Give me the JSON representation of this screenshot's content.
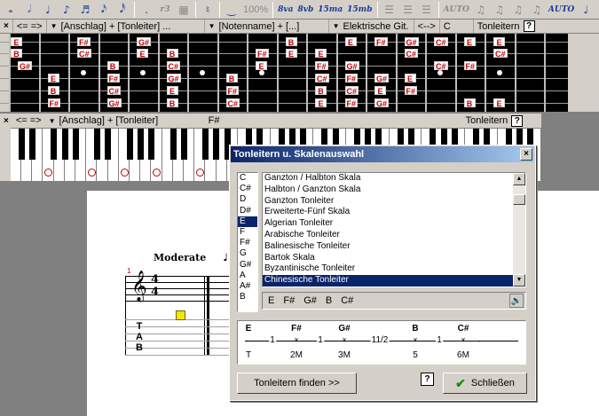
{
  "toolbar": {
    "items": [
      "𝅝",
      "𝅗𝅥",
      "♩",
      "♪",
      "♬",
      "𝅘𝅥𝅯",
      "𝅘𝅥𝅰",
      ".",
      "r3",
      "♮",
      "‿",
      "100%",
      "8va",
      "8vb",
      "15ma",
      "15mb",
      "AUTO",
      "AUTO"
    ]
  },
  "fret_header": {
    "close": "×",
    "nav": "<=  =>",
    "filter1": "[Anschlag] + [Tonleiter] ...",
    "filter2": "[Notenname] + [...]",
    "instrument": "Elektrische Git.",
    "arrows": "<-->",
    "key": "C",
    "mode": "Tonleitern",
    "help": "?"
  },
  "fretboard": {
    "rows": [
      [
        {
          "f": 0,
          "n": "E"
        },
        {
          "f": 3,
          "n": "F#"
        },
        {
          "f": 5,
          "n": "G#"
        },
        {
          "f": 10,
          "n": "B"
        },
        {
          "f": 12,
          "n": "E"
        },
        {
          "f": 13,
          "n": "F#"
        },
        {
          "f": 14,
          "n": "G#"
        },
        {
          "f": 15,
          "n": "C#"
        },
        {
          "f": 16,
          "n": "E"
        },
        {
          "f": 17,
          "n": "E"
        }
      ],
      [
        {
          "f": 0,
          "n": "B"
        },
        {
          "f": 3,
          "n": "C#"
        },
        {
          "f": 5,
          "n": "E"
        },
        {
          "f": 6,
          "n": "B"
        },
        {
          "f": 9,
          "n": "F#"
        },
        {
          "f": 10,
          "n": "E"
        },
        {
          "f": 11,
          "n": "E"
        },
        {
          "f": 14,
          "n": "C#"
        },
        {
          "f": 17,
          "n": "C#"
        }
      ],
      [
        {
          "f": 1,
          "n": "G#"
        },
        {
          "f": 4,
          "n": "B"
        },
        {
          "f": 6,
          "n": "C#"
        },
        {
          "f": 9,
          "n": "E"
        },
        {
          "f": 11,
          "n": "F#"
        },
        {
          "f": 12,
          "n": "G#"
        },
        {
          "f": 15,
          "n": "C#"
        },
        {
          "f": 16,
          "n": "F#"
        }
      ],
      [
        {
          "f": 2,
          "n": "E"
        },
        {
          "f": 4,
          "n": "F#"
        },
        {
          "f": 6,
          "n": "G#"
        },
        {
          "f": 8,
          "n": "B"
        },
        {
          "f": 11,
          "n": "C#"
        },
        {
          "f": 12,
          "n": "F#"
        },
        {
          "f": 13,
          "n": "G#"
        },
        {
          "f": 14,
          "n": "E"
        }
      ],
      [
        {
          "f": 2,
          "n": "B"
        },
        {
          "f": 4,
          "n": "C#"
        },
        {
          "f": 6,
          "n": "E"
        },
        {
          "f": 8,
          "n": "F#"
        },
        {
          "f": 11,
          "n": "B"
        },
        {
          "f": 12,
          "n": "C#"
        },
        {
          "f": 13,
          "n": "E"
        },
        {
          "f": 14,
          "n": "F#"
        }
      ],
      [
        {
          "f": 2,
          "n": "F#"
        },
        {
          "f": 4,
          "n": "G#"
        },
        {
          "f": 6,
          "n": "B"
        },
        {
          "f": 8,
          "n": "C#"
        },
        {
          "f": 11,
          "n": "E"
        },
        {
          "f": 12,
          "n": "F#"
        },
        {
          "f": 13,
          "n": "G#"
        },
        {
          "f": 16,
          "n": "B"
        },
        {
          "f": 17,
          "n": "E"
        }
      ]
    ]
  },
  "piano_header": {
    "close": "×",
    "nav": "<=  =>",
    "filter": "[Anschlag] + [Tonleiter]",
    "current": "F#",
    "mode": "Tonleitern",
    "help": "?"
  },
  "piano_marks": [
    "o",
    "o",
    "o",
    "o",
    "o",
    "o",
    "o",
    "o",
    "o",
    "o",
    "o"
  ],
  "score": {
    "tempo": "Moderate",
    "tempo_symbol": "𝅘𝅥 =",
    "measure": "1",
    "time_sig_top": "4",
    "time_sig_bottom": "4",
    "tab_t": "T",
    "tab_a": "A",
    "tab_b": "B"
  },
  "dialog": {
    "title": "Tonleitern u. Skalenauswahl",
    "close": "×",
    "keys": [
      "C",
      "C#",
      "D",
      "D#",
      "E",
      "F",
      "F#",
      "G",
      "G#",
      "A",
      "A#",
      "B"
    ],
    "selected_key": "E",
    "scales": [
      "Ganzton / Halbton Skala",
      "Halbton / Ganzton Skala",
      "Ganzton Tonleiter",
      "Erweiterte-Fünf Skala",
      "Algerian Tonleiter",
      "Arabische Tonleiter",
      "Balinesische Tonleiter",
      "Bartok Skala",
      "Byzantinische Tonleiter",
      "Chinesische Tonleiter"
    ],
    "selected_scale": "Chinesische Tonleiter",
    "scale_notes": [
      "E",
      "F#",
      "G#",
      "B",
      "C#"
    ],
    "intervals": {
      "notes": [
        "E",
        "F#",
        "G#",
        "B",
        "C#"
      ],
      "degrees": [
        "T",
        "2M",
        "3M",
        "5",
        "6M"
      ],
      "steps": [
        "1",
        "1",
        "11/2",
        "1"
      ]
    },
    "find_button": "Tonleitern finden  >>",
    "help": "?",
    "close_button": "Schließen"
  }
}
